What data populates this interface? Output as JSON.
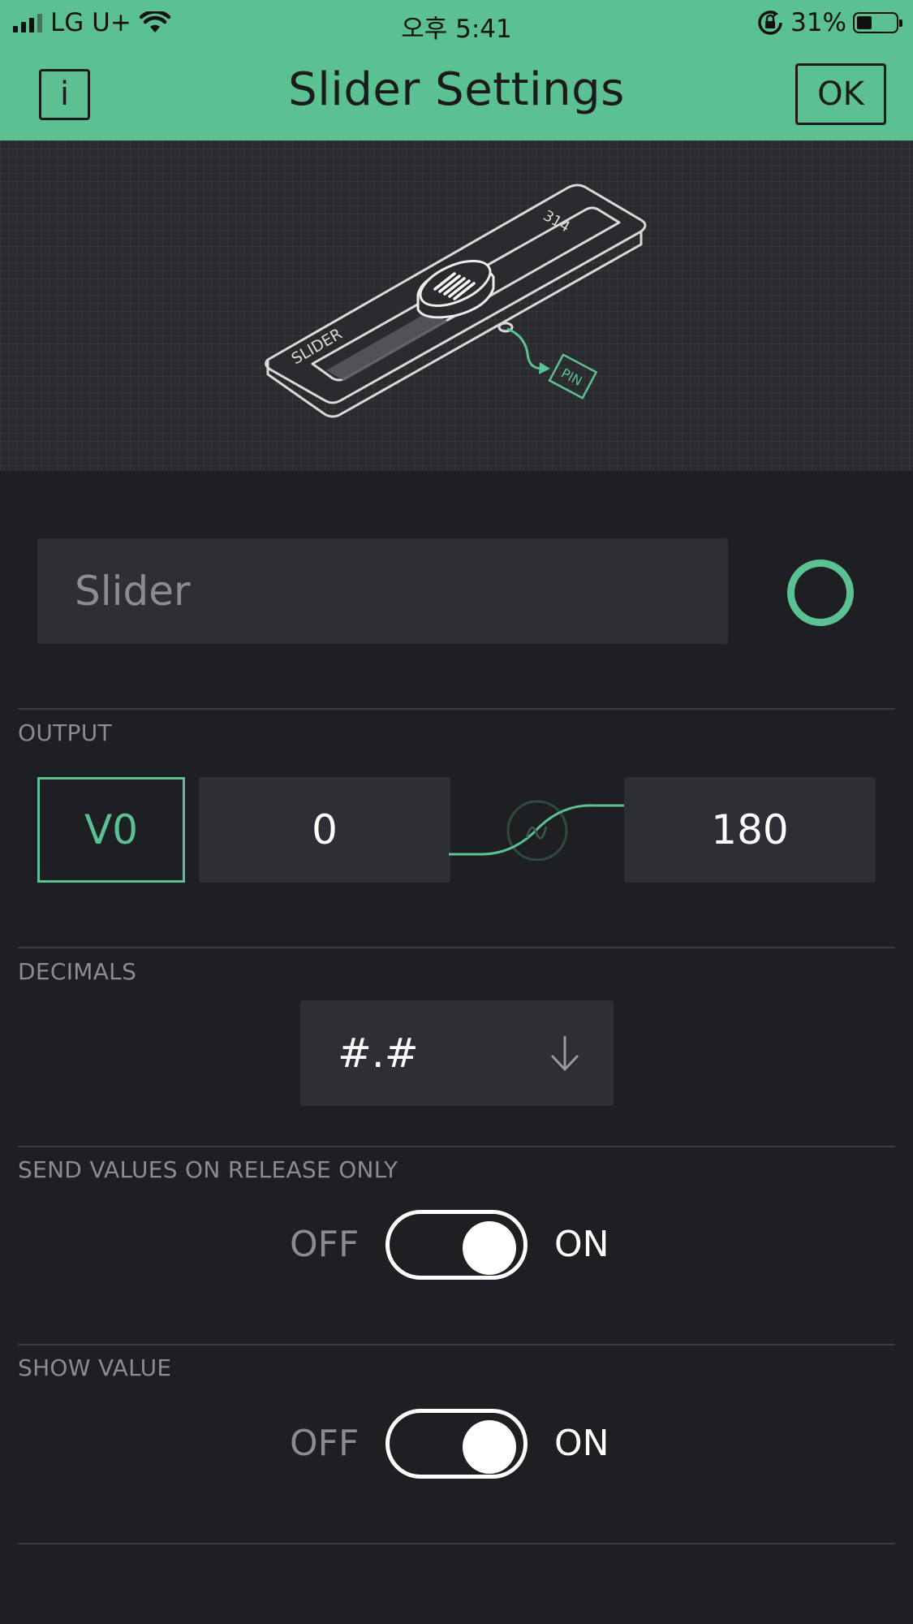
{
  "status_bar": {
    "carrier": "LG U+",
    "time": "오후 5:41",
    "battery": "31%",
    "battery_level": 0.31
  },
  "header": {
    "title": "Slider Settings",
    "info_label": "i",
    "ok_label": "OK"
  },
  "preview": {
    "widget_label": "SLIDER",
    "widget_value": "314",
    "pin_label": "PIN"
  },
  "name_field": {
    "placeholder": "Slider",
    "accent_color": "#5cc192"
  },
  "output": {
    "label": "OUTPUT",
    "pin": "V0",
    "min": "0",
    "max": "180"
  },
  "decimals": {
    "label": "DECIMALS",
    "value": "#.#"
  },
  "send_on_release": {
    "label": "SEND VALUES ON RELEASE ONLY",
    "off_label": "OFF",
    "on_label": "ON",
    "state": "on"
  },
  "show_value": {
    "label": "SHOW VALUE",
    "off_label": "OFF",
    "on_label": "ON",
    "state": "on"
  },
  "colors": {
    "accent": "#5cc192",
    "background": "#1e1f23",
    "field": "#2e2f34"
  }
}
